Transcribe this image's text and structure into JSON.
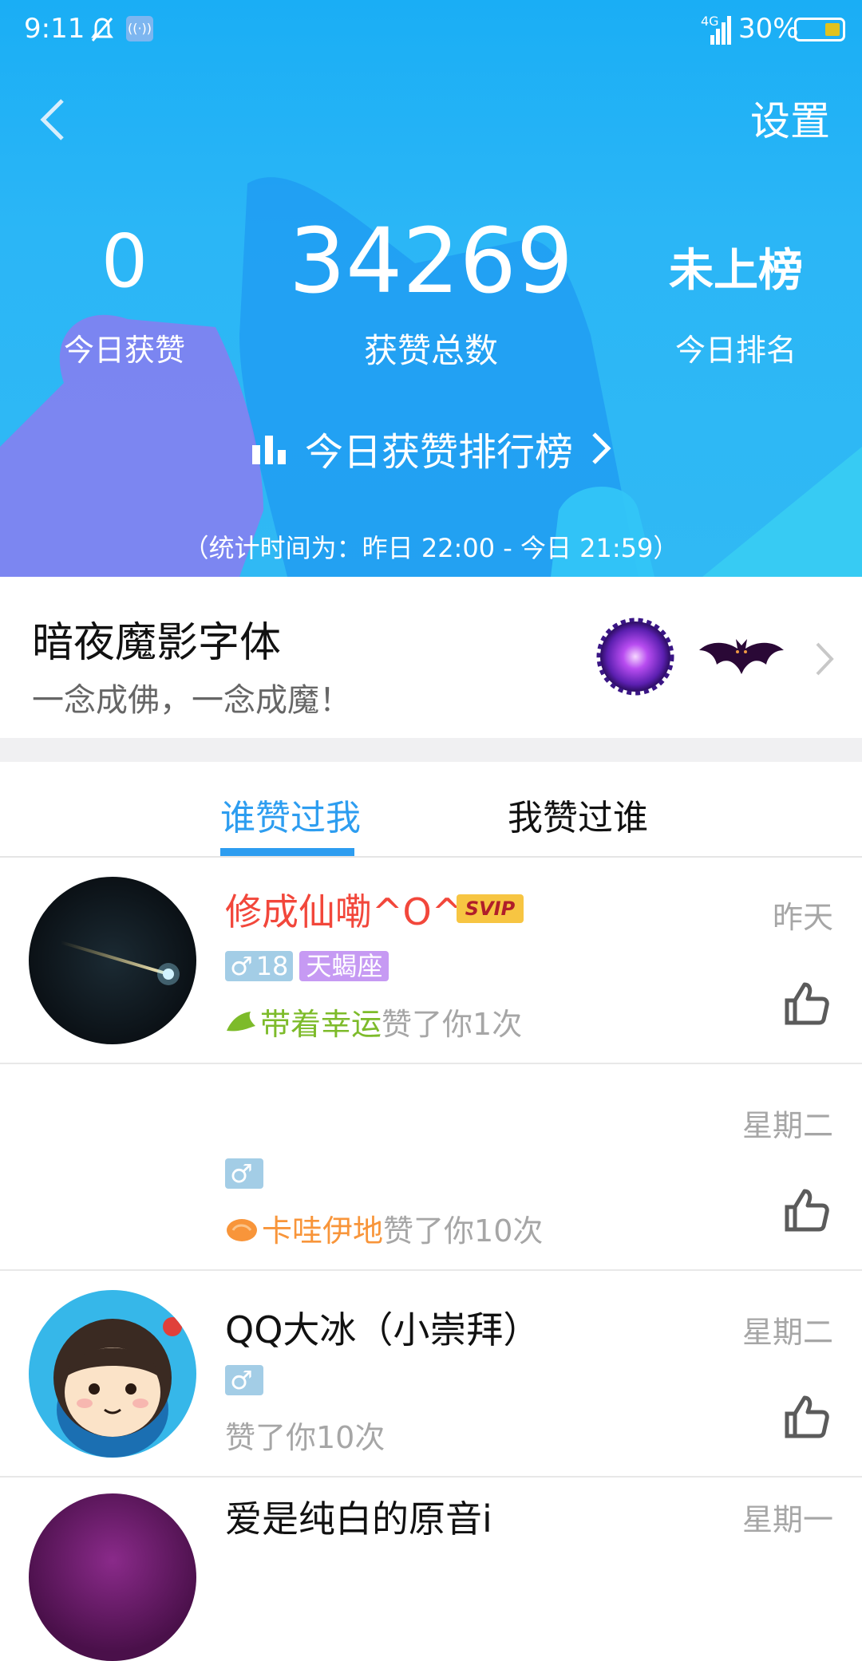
{
  "status_bar": {
    "time": "9:11",
    "network": "4G",
    "battery": "30%"
  },
  "header": {
    "settings_label": "设置"
  },
  "stats": {
    "today_likes": {
      "value": "0",
      "label": "今日获赞"
    },
    "total_likes": {
      "value": "34269",
      "label": "获赞总数"
    },
    "today_rank": {
      "value": "未上榜",
      "label": "今日排名"
    }
  },
  "leaderboard_link": "今日获赞排行榜",
  "stat_period": "（统计时间为：昨日 22:00 - 今日 21:59）",
  "font_banner": {
    "title": "暗夜魔影字体",
    "subtitle": "一念成佛，一念成魔！"
  },
  "tabs": [
    {
      "label": "谁赞过我",
      "active": true
    },
    {
      "label": "我赞过谁",
      "active": false
    }
  ],
  "list": [
    {
      "name": "修成仙嘞^O^",
      "vip_badge": "SVIP",
      "date": "昨天",
      "gender": "♂",
      "age": "18",
      "constellation": "天蝎座",
      "medal_text": "带着幸运",
      "like_text": "赞了你1次"
    },
    {
      "name": "",
      "date": "星期二",
      "gender": "♂",
      "medal_text": "卡哇伊地",
      "like_text": "赞了你10次"
    },
    {
      "name": "QQ大冰（小崇拜）",
      "date": "星期二",
      "gender": "♂",
      "like_text": "赞了你10次"
    },
    {
      "name": "爱是纯白的原音i",
      "date": "星期一"
    }
  ],
  "colors": {
    "accent": "#2d9df0",
    "name_red": "#f2473b",
    "medal_green": "#7dbb2a",
    "medal_orange": "#f8953a"
  }
}
